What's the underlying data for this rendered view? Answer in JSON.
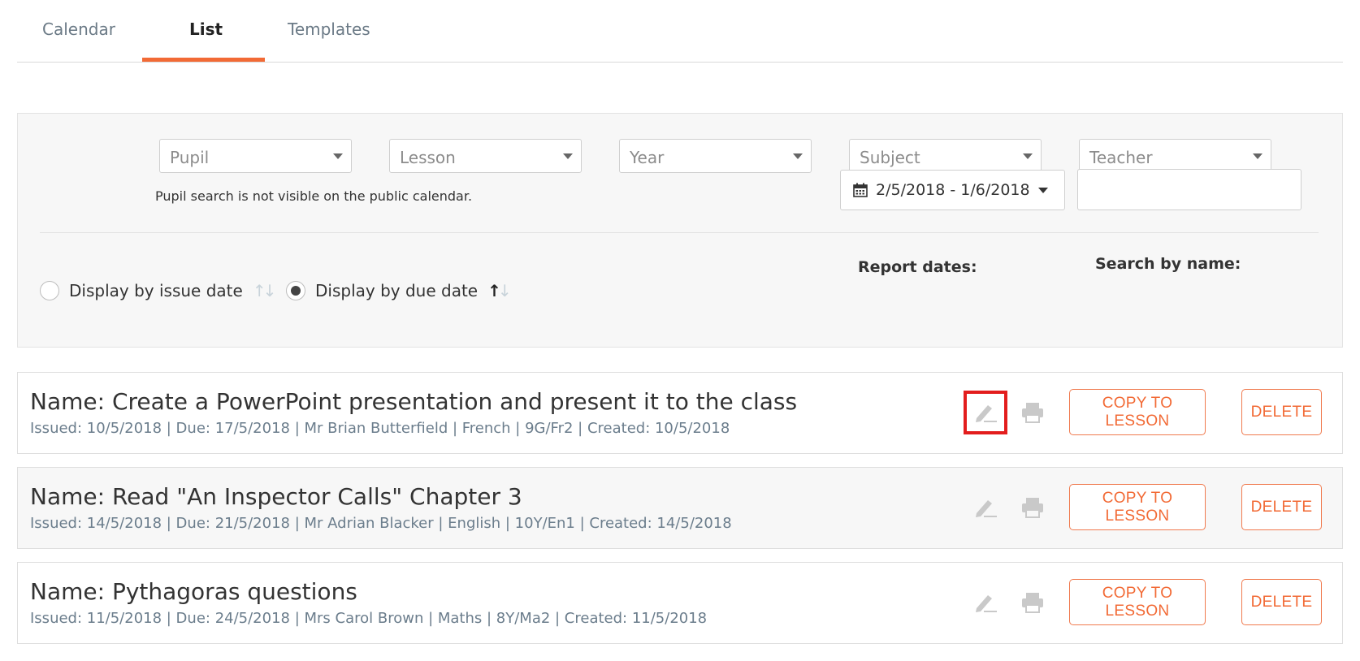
{
  "tabs": [
    {
      "label": "Calendar",
      "active": false
    },
    {
      "label": "List",
      "active": true
    },
    {
      "label": "Templates",
      "active": false
    }
  ],
  "filters": {
    "selects": [
      {
        "placeholder": "Pupil"
      },
      {
        "placeholder": "Lesson"
      },
      {
        "placeholder": "Year"
      },
      {
        "placeholder": "Subject"
      },
      {
        "placeholder": "Teacher"
      }
    ],
    "pupil_note": "Pupil search is not visible on the public calendar.",
    "display_issue_label": "Display by issue date",
    "display_due_label": "Display by due date",
    "selected_display": "due",
    "report_dates_label": "Report dates:",
    "report_dates_value": "2/5/2018 - 1/6/2018",
    "search_label": "Search by name:",
    "search_value": ""
  },
  "homework": [
    {
      "title": "Name: Create a PowerPoint presentation and present it to the class",
      "meta": "Issued: 10/5/2018 | Due: 17/5/2018 | Mr Brian Butterfield | French | 9G/Fr2 | Created: 10/5/2018",
      "copy_label": "COPY TO LESSON",
      "delete_label": "DELETE",
      "edit_highlighted": true
    },
    {
      "title": "Name: Read \"An Inspector Calls\" Chapter 3",
      "meta": "Issued: 14/5/2018 | Due: 21/5/2018 | Mr Adrian Blacker | English | 10Y/En1 | Created: 14/5/2018",
      "copy_label": "COPY TO LESSON",
      "delete_label": "DELETE",
      "edit_highlighted": false
    },
    {
      "title": "Name: Pythagoras questions",
      "meta": "Issued: 11/5/2018 | Due: 24/5/2018 | Mrs Carol Brown | Maths | 8Y/Ma2 | Created: 11/5/2018",
      "copy_label": "COPY TO LESSON",
      "delete_label": "DELETE",
      "edit_highlighted": false
    }
  ],
  "colors": {
    "accent": "#f26a35",
    "highlight": "#e31d1d",
    "meta_text": "#6b7d8c"
  },
  "icons": [
    "calendar-icon",
    "pencil-icon",
    "print-icon",
    "sort-icon",
    "caret-down-icon"
  ]
}
